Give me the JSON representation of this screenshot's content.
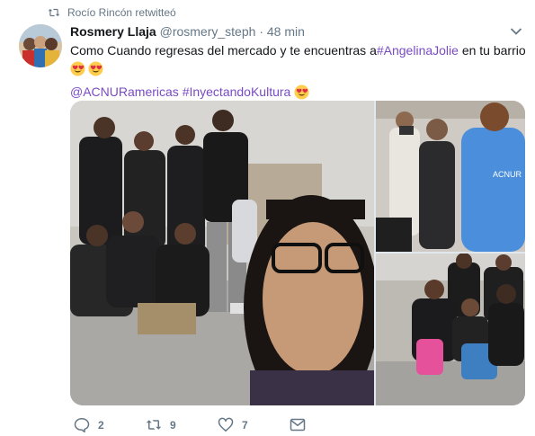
{
  "retweet_context": {
    "text": "Rocío Rincón retwitteó"
  },
  "author": {
    "name": "Rosmery Llaja",
    "handle": "@rosmery_steph",
    "separator": "·",
    "time": "48 min"
  },
  "tweet": {
    "line1_before": "Como Cuando regresas del mercado y te encuentras a ",
    "line1_hashtag": "#AngelinaJolie",
    "line1_after": " en tu barrio",
    "mention": "@ACNURamericas",
    "hashtag2": "#InyectandoKultura",
    "emoji_name": "heart-eyes-face"
  },
  "media": {
    "photos": [
      {
        "name": "selfie-with-group"
      },
      {
        "name": "acnur-vest-photographers"
      },
      {
        "name": "group-crouching-photo"
      }
    ]
  },
  "actions": {
    "reply_count": "2",
    "retweet_count": "9",
    "like_count": "7"
  },
  "colors": {
    "link": "#794bc4",
    "secondary": "#657786",
    "text": "#14171a"
  }
}
